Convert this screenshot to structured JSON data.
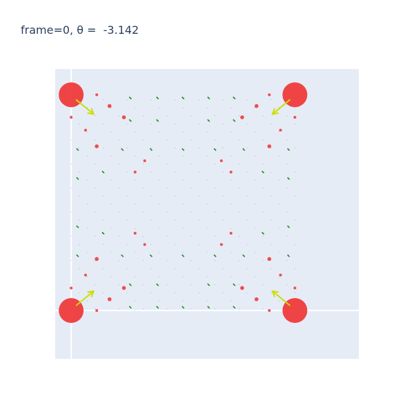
{
  "chart_data": {
    "type": "scatter",
    "title": "frame=0, θ =  -3.142",
    "xlim": [
      -0.5,
      9.0
    ],
    "ylim": [
      -1.5,
      7.5
    ],
    "grid": true,
    "legend": "none",
    "colors": {
      "plot_bg": "#e5ecf6",
      "zero_line": "#ffffff",
      "marker": "#ef3b3b",
      "arrow": "#ccdd00",
      "small_mark": "#1a8a1a",
      "tiny_mark": "#1f4f8f"
    },
    "big_points": [
      {
        "x": 0.0,
        "y": 0.0
      },
      {
        "x": 7.0,
        "y": 0.0
      },
      {
        "x": 0.0,
        "y": 6.7
      },
      {
        "x": 7.0,
        "y": 6.7
      }
    ],
    "arrows": [
      {
        "x": 0.15,
        "y": 6.55,
        "dx": 0.55,
        "dy": -0.45
      },
      {
        "x": 6.85,
        "y": 6.55,
        "dx": -0.55,
        "dy": -0.45
      },
      {
        "x": 0.15,
        "y": 0.15,
        "dx": 0.55,
        "dy": 0.45
      },
      {
        "x": 6.85,
        "y": 0.15,
        "dx": -0.55,
        "dy": 0.45
      }
    ],
    "red_points": [
      {
        "x": 0.8,
        "y": 6.7
      },
      {
        "x": 1.2,
        "y": 6.35
      },
      {
        "x": 0.0,
        "y": 6.0
      },
      {
        "x": 1.65,
        "y": 6.0
      },
      {
        "x": 0.45,
        "y": 5.6
      },
      {
        "x": 0.8,
        "y": 5.1
      },
      {
        "x": 2.3,
        "y": 4.65
      },
      {
        "x": 2.0,
        "y": 4.3
      },
      {
        "x": 6.2,
        "y": 6.7
      },
      {
        "x": 5.8,
        "y": 6.35
      },
      {
        "x": 7.0,
        "y": 6.0
      },
      {
        "x": 5.35,
        "y": 6.0
      },
      {
        "x": 6.55,
        "y": 5.6
      },
      {
        "x": 6.2,
        "y": 5.1
      },
      {
        "x": 4.7,
        "y": 4.65
      },
      {
        "x": 5.0,
        "y": 4.3
      },
      {
        "x": 0.8,
        "y": 0.0
      },
      {
        "x": 1.2,
        "y": 0.35
      },
      {
        "x": 0.0,
        "y": 0.7
      },
      {
        "x": 1.65,
        "y": 0.7
      },
      {
        "x": 0.45,
        "y": 1.1
      },
      {
        "x": 0.8,
        "y": 1.6
      },
      {
        "x": 2.3,
        "y": 2.05
      },
      {
        "x": 2.0,
        "y": 2.4
      },
      {
        "x": 6.2,
        "y": 0.0
      },
      {
        "x": 5.8,
        "y": 0.35
      },
      {
        "x": 7.0,
        "y": 0.7
      },
      {
        "x": 5.35,
        "y": 0.7
      },
      {
        "x": 6.55,
        "y": 1.1
      },
      {
        "x": 6.2,
        "y": 1.6
      },
      {
        "x": 4.7,
        "y": 2.05
      },
      {
        "x": 5.0,
        "y": 2.4
      }
    ],
    "green_marks": [
      {
        "x": 1.85,
        "y": 6.6
      },
      {
        "x": 2.7,
        "y": 6.6
      },
      {
        "x": 3.5,
        "y": 6.6
      },
      {
        "x": 4.3,
        "y": 6.6
      },
      {
        "x": 5.1,
        "y": 6.6
      },
      {
        "x": 1.85,
        "y": 5.9
      },
      {
        "x": 2.7,
        "y": 5.9
      },
      {
        "x": 4.3,
        "y": 5.9
      },
      {
        "x": 5.1,
        "y": 5.9
      },
      {
        "x": 0.2,
        "y": 5.0
      },
      {
        "x": 1.6,
        "y": 5.0
      },
      {
        "x": 2.5,
        "y": 5.0
      },
      {
        "x": 3.5,
        "y": 5.0
      },
      {
        "x": 4.5,
        "y": 5.0
      },
      {
        "x": 5.4,
        "y": 5.0
      },
      {
        "x": 6.8,
        "y": 5.0
      },
      {
        "x": 1.0,
        "y": 4.3
      },
      {
        "x": 6.0,
        "y": 4.3
      },
      {
        "x": 0.2,
        "y": 4.1
      },
      {
        "x": 6.8,
        "y": 4.1
      },
      {
        "x": 0.2,
        "y": 2.6
      },
      {
        "x": 6.8,
        "y": 2.6
      },
      {
        "x": 1.0,
        "y": 2.4
      },
      {
        "x": 6.0,
        "y": 2.4
      },
      {
        "x": 0.2,
        "y": 1.7
      },
      {
        "x": 1.6,
        "y": 1.7
      },
      {
        "x": 2.5,
        "y": 1.7
      },
      {
        "x": 3.5,
        "y": 1.7
      },
      {
        "x": 4.5,
        "y": 1.7
      },
      {
        "x": 5.4,
        "y": 1.7
      },
      {
        "x": 6.8,
        "y": 1.7
      },
      {
        "x": 1.85,
        "y": 0.8
      },
      {
        "x": 2.7,
        "y": 0.8
      },
      {
        "x": 4.3,
        "y": 0.8
      },
      {
        "x": 5.1,
        "y": 0.8
      },
      {
        "x": 1.85,
        "y": 0.1
      },
      {
        "x": 2.7,
        "y": 0.1
      },
      {
        "x": 3.5,
        "y": 0.1
      },
      {
        "x": 4.3,
        "y": 0.1
      },
      {
        "x": 5.1,
        "y": 0.1
      }
    ]
  }
}
